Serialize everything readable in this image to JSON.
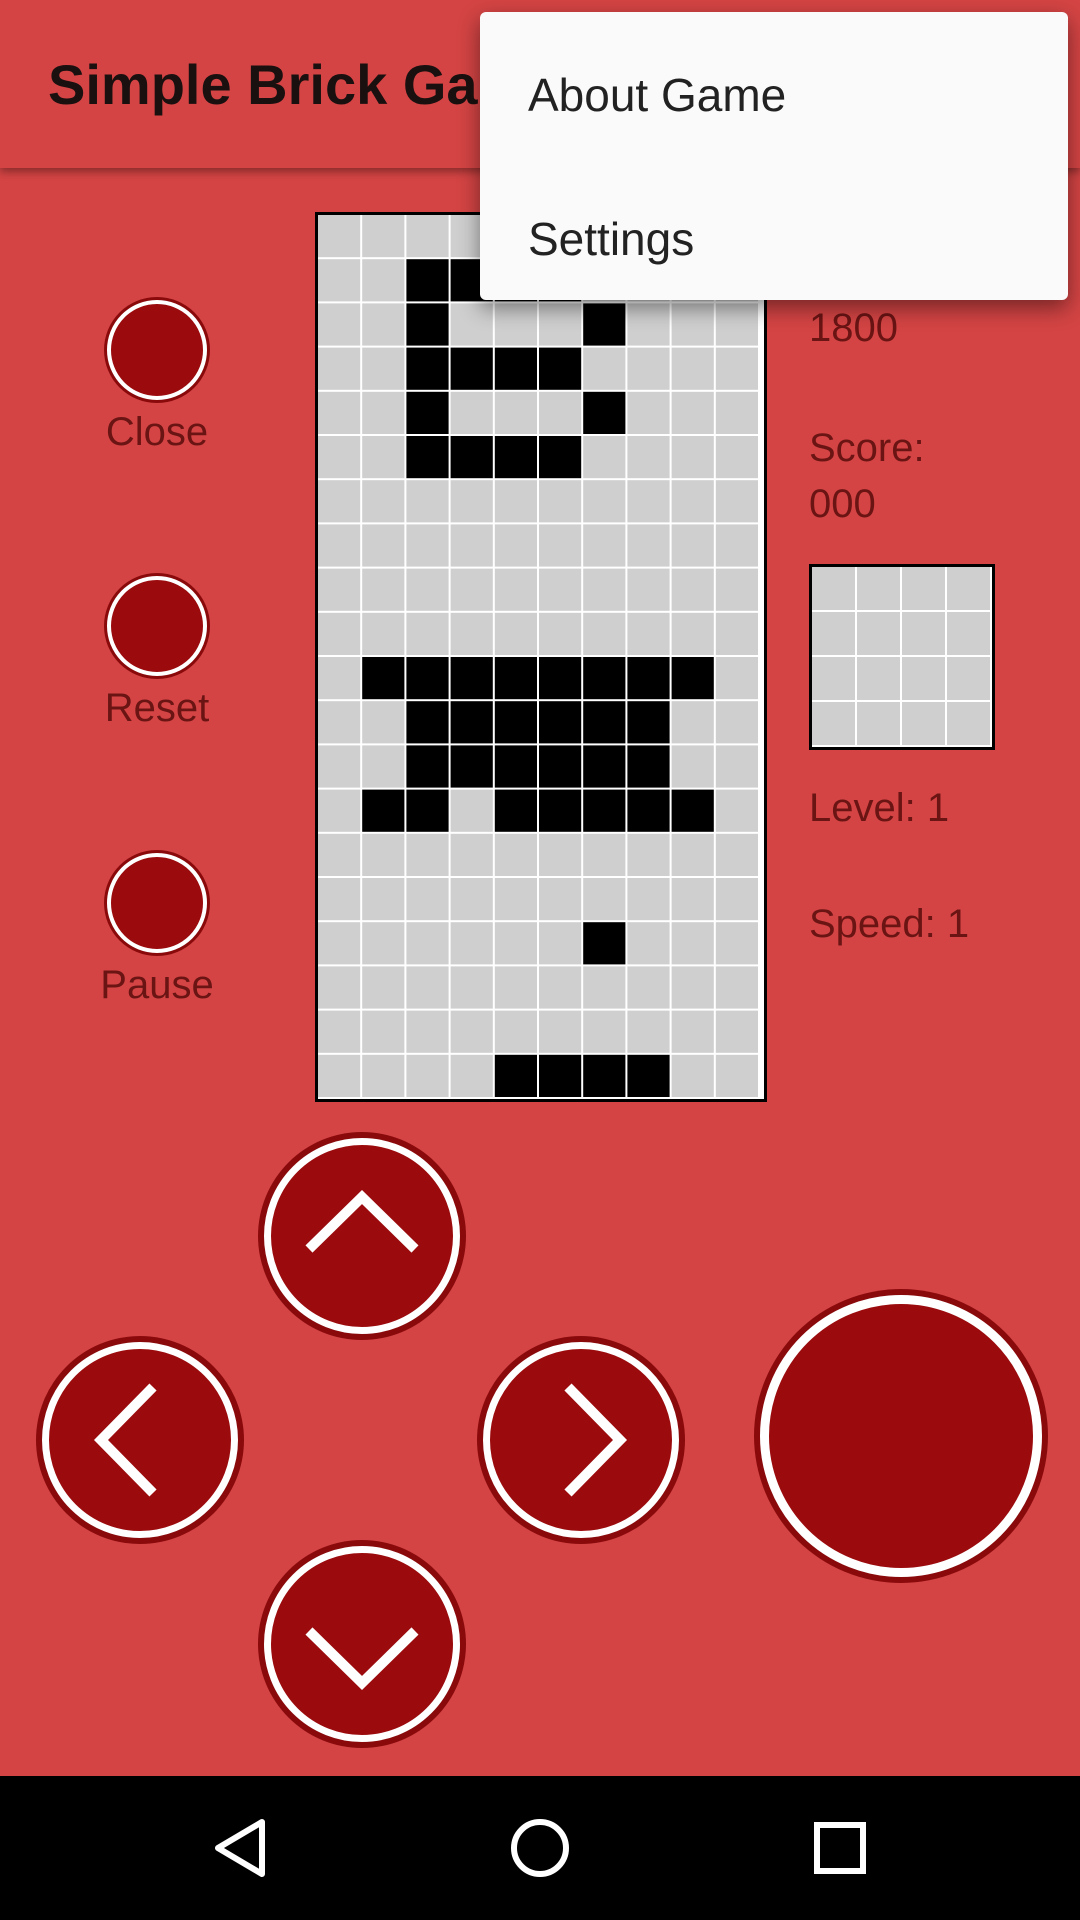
{
  "app": {
    "title": "Simple Brick Game"
  },
  "menu": {
    "items": [
      "About Game",
      "Settings"
    ]
  },
  "side_buttons": {
    "close": "Close",
    "reset": "Reset",
    "pause": "Pause"
  },
  "info": {
    "hiscore": "1800",
    "score_label": "Score:",
    "score": "000",
    "level": "Level: 1",
    "speed": "Speed: 1"
  },
  "board": {
    "columns": 10,
    "rows": 20,
    "filled": [
      [
        1,
        2
      ],
      [
        1,
        3
      ],
      [
        1,
        4
      ],
      [
        1,
        5
      ],
      [
        2,
        2
      ],
      [
        2,
        6
      ],
      [
        3,
        2
      ],
      [
        3,
        3
      ],
      [
        3,
        4
      ],
      [
        3,
        5
      ],
      [
        4,
        2
      ],
      [
        4,
        6
      ],
      [
        5,
        2
      ],
      [
        5,
        3
      ],
      [
        5,
        4
      ],
      [
        5,
        5
      ],
      [
        10,
        1
      ],
      [
        10,
        2
      ],
      [
        10,
        3
      ],
      [
        10,
        4
      ],
      [
        10,
        5
      ],
      [
        10,
        6
      ],
      [
        10,
        7
      ],
      [
        10,
        8
      ],
      [
        11,
        2
      ],
      [
        11,
        3
      ],
      [
        11,
        4
      ],
      [
        11,
        5
      ],
      [
        11,
        6
      ],
      [
        11,
        7
      ],
      [
        12,
        2
      ],
      [
        12,
        3
      ],
      [
        12,
        4
      ],
      [
        12,
        5
      ],
      [
        12,
        6
      ],
      [
        12,
        7
      ],
      [
        13,
        1
      ],
      [
        13,
        2
      ],
      [
        13,
        4
      ],
      [
        13,
        5
      ],
      [
        13,
        6
      ],
      [
        13,
        7
      ],
      [
        13,
        8
      ],
      [
        16,
        6
      ],
      [
        19,
        4
      ],
      [
        19,
        5
      ],
      [
        19,
        6
      ],
      [
        19,
        7
      ]
    ]
  },
  "next_preview": {
    "columns": 4,
    "rows": 4,
    "filled": []
  },
  "colors": {
    "background": "#d44444",
    "button": "#9b0b0d",
    "cell_empty": "#cfcfcf",
    "cell_filled": "#000000",
    "text": "#6b1414"
  },
  "controls": {
    "up": "chevron-up-icon",
    "down": "chevron-down-icon",
    "left": "chevron-left-icon",
    "right": "chevron-right-icon",
    "rotate": "rotate-button"
  },
  "system_nav": {
    "back": "back-triangle-icon",
    "home": "home-circle-icon",
    "recents": "recents-square-icon"
  }
}
